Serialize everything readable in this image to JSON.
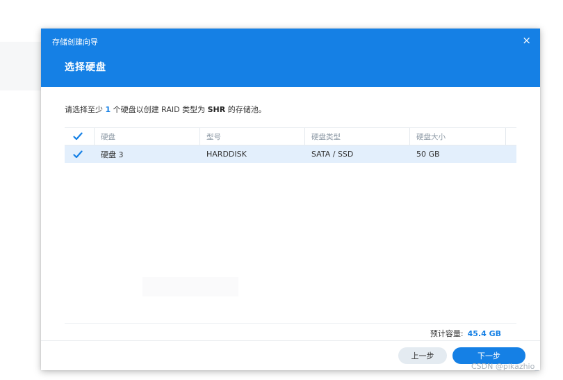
{
  "dialog": {
    "wizard_title": "存储创建向导",
    "close_label": "×",
    "step_title": "选择硬盘"
  },
  "instruction": {
    "prefix": "请选择至少",
    "count": "1",
    "middle": "个硬盘以创建 RAID 类型为",
    "raid_type": "SHR",
    "suffix": "的存储池。"
  },
  "table": {
    "columns": [
      "硬盘",
      "型号",
      "硬盘类型",
      "硬盘大小"
    ],
    "header_checked": true,
    "rows": [
      {
        "checked": true,
        "disk": "硬盘 3",
        "model": "HARDDISK",
        "type": "SATA / SSD",
        "size": "50 GB"
      }
    ]
  },
  "footer": {
    "capacity_label": "预计容量:",
    "capacity_value": "45.4 GB",
    "prev_label": "上一步",
    "next_label": "下一步"
  },
  "watermark": "CSDN @pikazhio_",
  "colors": {
    "accent": "#1580e5",
    "row_selected": "#e3effc"
  },
  "icons": {
    "close": "close-icon",
    "checkbox": "checkmark-icon"
  }
}
